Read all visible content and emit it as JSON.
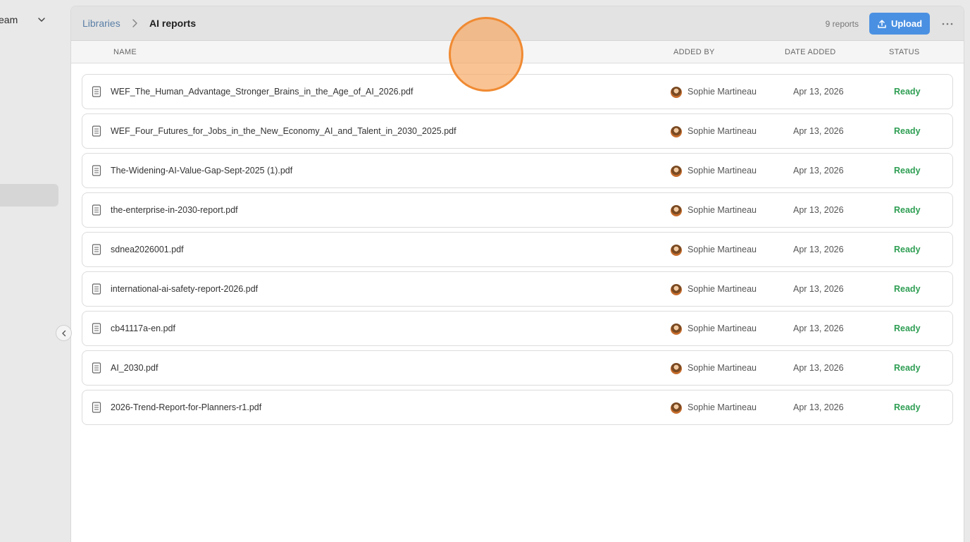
{
  "sidebar": {
    "team_label": "eam"
  },
  "breadcrumb": {
    "libraries": "Libraries",
    "current": "AI reports"
  },
  "toolbar": {
    "count": "9 reports",
    "upload_label": "Upload"
  },
  "columns": {
    "name": "NAME",
    "added_by": "ADDED BY",
    "date_added": "DATE ADDED",
    "status": "STATUS"
  },
  "rows": [
    {
      "name": "WEF_The_Human_Advantage_Stronger_Brains_in_the_Age_of_AI_2026.pdf",
      "added_by": "Sophie Martineau",
      "date": "Apr 13, 2026",
      "status": "Ready"
    },
    {
      "name": "WEF_Four_Futures_for_Jobs_in_the_New_Economy_AI_and_Talent_in_2030_2025.pdf",
      "added_by": "Sophie Martineau",
      "date": "Apr 13, 2026",
      "status": "Ready"
    },
    {
      "name": "The-Widening-AI-Value-Gap-Sept-2025 (1).pdf",
      "added_by": "Sophie Martineau",
      "date": "Apr 13, 2026",
      "status": "Ready"
    },
    {
      "name": "the-enterprise-in-2030-report.pdf",
      "added_by": "Sophie Martineau",
      "date": "Apr 13, 2026",
      "status": "Ready"
    },
    {
      "name": "sdnea2026001.pdf",
      "added_by": "Sophie Martineau",
      "date": "Apr 13, 2026",
      "status": "Ready"
    },
    {
      "name": "international-ai-safety-report-2026.pdf",
      "added_by": "Sophie Martineau",
      "date": "Apr 13, 2026",
      "status": "Ready"
    },
    {
      "name": "cb41117a-en.pdf",
      "added_by": "Sophie Martineau",
      "date": "Apr 13, 2026",
      "status": "Ready"
    },
    {
      "name": "AI_2030.pdf",
      "added_by": "Sophie Martineau",
      "date": "Apr 13, 2026",
      "status": "Ready"
    },
    {
      "name": "2026-Trend-Report-for-Planners-r1.pdf",
      "added_by": "Sophie Martineau",
      "date": "Apr 13, 2026",
      "status": "Ready"
    }
  ],
  "colors": {
    "accent": "#4a90e2",
    "status_ready": "#2e9e53",
    "link": "#5a7fa6"
  },
  "icons": {
    "team_chevron": "chevron-down-icon",
    "breadcrumb_sep": "chevron-right-icon",
    "upload": "upload-icon",
    "more": "more-horizontal-icon",
    "file": "document-icon",
    "collapse": "chevron-left-icon"
  }
}
